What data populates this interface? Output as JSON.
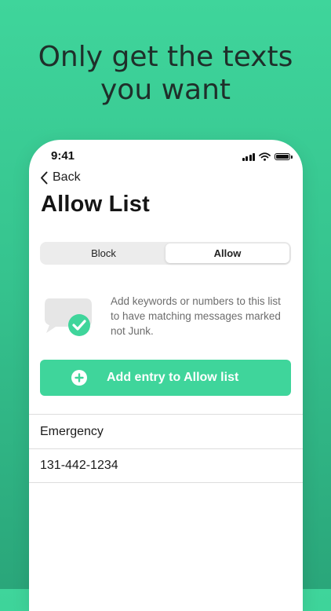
{
  "headline": {
    "line1": "Only get the texts",
    "line2": "you want"
  },
  "status_bar": {
    "time": "9:41"
  },
  "nav": {
    "back_label": "Back"
  },
  "page": {
    "title": "Allow List"
  },
  "segmented_control": {
    "options": [
      "Block",
      "Allow"
    ],
    "selected": "Allow"
  },
  "info": {
    "text": "Add keywords or numbers to this list to have matching messages marked not Junk."
  },
  "add_button": {
    "label": "Add entry to Allow list"
  },
  "entries": [
    "Emergency",
    "131-442-1234"
  ],
  "colors": {
    "accent": "#3fd59b",
    "background_top": "#3fd59b",
    "background_bottom": "#2aa67a"
  },
  "icons": [
    "chevron-left-icon",
    "signal-icon",
    "wifi-icon",
    "battery-icon",
    "message-check-icon",
    "plus-circle-icon"
  ]
}
